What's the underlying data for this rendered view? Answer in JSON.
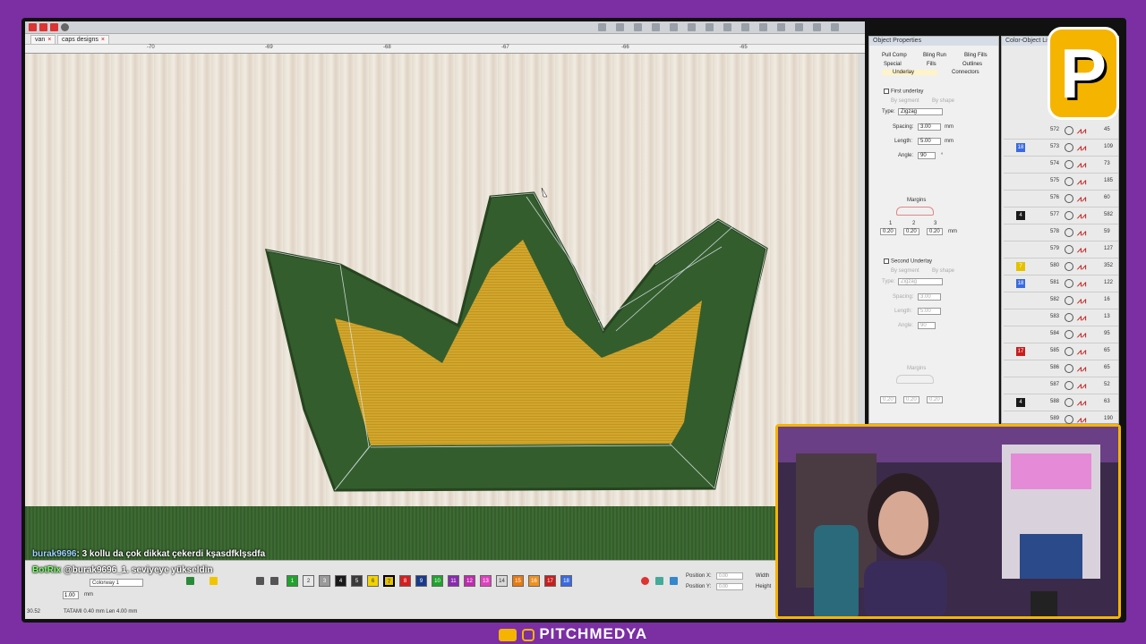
{
  "tabs": [
    {
      "label": "van"
    },
    {
      "label": "caps designs"
    }
  ],
  "ruler_labels": [
    "-70",
    "-69",
    "-68",
    "-67",
    "-66",
    "-65"
  ],
  "chat": {
    "user": "burak9696",
    "message": ": 3 kollu da çok dikkat çekerdi kşasdfklşsdfa"
  },
  "botrix": {
    "name": "BotRix",
    "message": "@burak9696_1. seviyeye yükseldin"
  },
  "bottom": {
    "colorway": "Colorway 1",
    "step_value": "1.00",
    "step_unit": "mm",
    "position_x_label": "Position X:",
    "position_y_label": "Position Y:",
    "position_x_value": "0.00",
    "position_y_value": "0.00",
    "width_label": "Width",
    "height_label": "Height",
    "status_left": "30.52",
    "status_main": "TATAMI 0.40 mm Len 4.00 mm"
  },
  "swatches": [
    {
      "n": "1",
      "c": "#1fa32c"
    },
    {
      "n": "2",
      "c": "#e8e8e8"
    },
    {
      "n": "3",
      "c": "#9a9a9a"
    },
    {
      "n": "4",
      "c": "#1a1a1a"
    },
    {
      "n": "5",
      "c": "#3a3a3a"
    },
    {
      "n": "6",
      "c": "#f2d200"
    },
    {
      "n": "7",
      "c": "#e4c200"
    },
    {
      "n": "8",
      "c": "#d32020"
    },
    {
      "n": "9",
      "c": "#1a3a8a"
    },
    {
      "n": "10",
      "c": "#1fa32c"
    },
    {
      "n": "11",
      "c": "#8a2ab0"
    },
    {
      "n": "12",
      "c": "#c02ab0"
    },
    {
      "n": "13",
      "c": "#e040c0"
    },
    {
      "n": "14",
      "c": "#d8d8d8"
    },
    {
      "n": "15",
      "c": "#e87a10"
    },
    {
      "n": "16",
      "c": "#f09020"
    },
    {
      "n": "17",
      "c": "#c81e1e"
    },
    {
      "n": "18",
      "c": "#3a6ae0"
    }
  ],
  "object_properties": {
    "title": "Object Properties",
    "tabs_row1": [
      "Pull Comp",
      "Bling Run",
      "Bling Fills"
    ],
    "tabs_row2": [
      "Special",
      "Fills",
      "Outlines"
    ],
    "tabs_row3": [
      "Underlay",
      "Connectors"
    ],
    "first_underlay": "First underlay",
    "by_segment": "By segment",
    "by_shape": "By shape",
    "type_label": "Type:",
    "type_value": "Zigzag",
    "spacing_label": "Spacing:",
    "spacing_value": "3.00",
    "length_label": "Length:",
    "length_value": "5.00",
    "angle_label": "Angle:",
    "angle_value": "90",
    "unit_mm": "mm",
    "unit_deg": "°",
    "margins_label": "Margins",
    "margin_values": [
      "0.20",
      "0.20",
      "0.20"
    ],
    "margin_idx": [
      "1",
      "2",
      "3"
    ],
    "second_underlay": "Second Underlay",
    "s_spacing_value": "3.00",
    "s_length_value": "5.00",
    "s_angle_value": "90",
    "s_margin_values": [
      "0.20",
      "0.20",
      "0.20"
    ]
  },
  "sequence": {
    "title": "Color-Object List",
    "rows": [
      {
        "num": "572",
        "count": "45",
        "badge": "",
        "badge_color": ""
      },
      {
        "num": "573",
        "count": "109",
        "badge": "18",
        "badge_color": "#3a6ae0"
      },
      {
        "num": "574",
        "count": "73",
        "badge": "",
        "badge_color": ""
      },
      {
        "num": "575",
        "count": "185",
        "badge": "",
        "badge_color": ""
      },
      {
        "num": "576",
        "count": "60",
        "badge": "",
        "badge_color": ""
      },
      {
        "num": "577",
        "count": "582",
        "badge": "4",
        "badge_color": "#1a1a1a"
      },
      {
        "num": "578",
        "count": "59",
        "badge": "",
        "badge_color": ""
      },
      {
        "num": "579",
        "count": "127",
        "badge": "",
        "badge_color": ""
      },
      {
        "num": "580",
        "count": "352",
        "badge": "7",
        "badge_color": "#e4c200"
      },
      {
        "num": "581",
        "count": "122",
        "badge": "18",
        "badge_color": "#3a6ae0"
      },
      {
        "num": "582",
        "count": "16",
        "badge": "",
        "badge_color": ""
      },
      {
        "num": "583",
        "count": "13",
        "badge": "",
        "badge_color": ""
      },
      {
        "num": "584",
        "count": "95",
        "badge": "",
        "badge_color": ""
      },
      {
        "num": "585",
        "count": "65",
        "badge": "17",
        "badge_color": "#c81e1e"
      },
      {
        "num": "586",
        "count": "65",
        "badge": "",
        "badge_color": ""
      },
      {
        "num": "587",
        "count": "52",
        "badge": "",
        "badge_color": ""
      },
      {
        "num": "588",
        "count": "63",
        "badge": "4",
        "badge_color": "#1a1a1a"
      },
      {
        "num": "589",
        "count": "190",
        "badge": "",
        "badge_color": ""
      }
    ]
  },
  "logo": {
    "letter": "P"
  },
  "footer": {
    "brand": "PITCHMEDYA"
  }
}
